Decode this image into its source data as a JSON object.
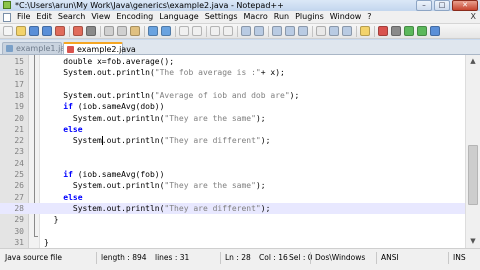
{
  "window": {
    "title": "*C:\\Users\\arun\\My Work\\Java\\generics\\example2.java - Notepad++",
    "minimize_label": "–",
    "maximize_label": "□",
    "close_label": "✕"
  },
  "menu": {
    "items": [
      "File",
      "Edit",
      "Search",
      "View",
      "Encoding",
      "Language",
      "Settings",
      "Macro",
      "Run",
      "Plugins",
      "Window",
      "?"
    ],
    "right_label": "X"
  },
  "toolbar": {
    "buttons": [
      "new-icon",
      "open-icon",
      "save-icon",
      "save-all-icon",
      "close-icon",
      "close-all-icon",
      "print-icon",
      "cut-icon",
      "copy-icon",
      "paste-icon",
      "undo-icon",
      "redo-icon",
      "find-icon",
      "replace-icon",
      "zoom-in-icon",
      "zoom-out-icon",
      "sync-v-icon",
      "sync-h-icon",
      "wrap-icon",
      "all-chars-icon",
      "indent-guide-icon",
      "lang-icon",
      "doc-map-icon",
      "func-list-icon",
      "folder-icon",
      "record-icon",
      "stop-icon",
      "play-icon",
      "play-multi-icon",
      "save-macro-icon"
    ]
  },
  "tabs": [
    {
      "label": "example1.java",
      "active": false
    },
    {
      "label": "example2.java",
      "active": true
    }
  ],
  "editor": {
    "current_line": 23,
    "lines": [
      {
        "num": "15",
        "parts": [
          {
            "t": "double x=fob.average();",
            "c": "plain"
          }
        ],
        "indent": 4
      },
      {
        "num": "16",
        "parts": [
          {
            "t": "System.out.println(",
            "c": "plain"
          },
          {
            "t": "\"The fob average is :\"",
            "c": "str"
          },
          {
            "t": "+ x);",
            "c": "plain"
          }
        ],
        "indent": 4
      },
      {
        "num": "17",
        "parts": [],
        "indent": 0
      },
      {
        "num": "18",
        "parts": [
          {
            "t": "System.out.println(",
            "c": "plain"
          },
          {
            "t": "\"Average of iob and dob are\"",
            "c": "str"
          },
          {
            "t": ");",
            "c": "plain"
          }
        ],
        "indent": 4
      },
      {
        "num": "19",
        "parts": [
          {
            "t": "if",
            "c": "kw"
          },
          {
            "t": " (iob.sameAvg(dob))",
            "c": "plain"
          }
        ],
        "indent": 4
      },
      {
        "num": "20",
        "parts": [
          {
            "t": "System.out.println(",
            "c": "plain"
          },
          {
            "t": "\"They are the same\"",
            "c": "str"
          },
          {
            "t": ");",
            "c": "plain"
          }
        ],
        "indent": 6
      },
      {
        "num": "21",
        "parts": [
          {
            "t": "else",
            "c": "kw"
          }
        ],
        "indent": 4
      },
      {
        "num": "22",
        "parts": [
          {
            "t": "System.out.println(",
            "c": "plain"
          },
          {
            "t": "\"They are different\"",
            "c": "str"
          },
          {
            "t": ");",
            "c": "plain"
          }
        ],
        "indent": 6
      },
      {
        "num": "23",
        "parts": [],
        "indent": 0
      },
      {
        "num": "24",
        "parts": [],
        "indent": 0
      },
      {
        "num": "25",
        "parts": [
          {
            "t": "if",
            "c": "kw"
          },
          {
            "t": " (iob.sameAvg(fob))",
            "c": "plain"
          }
        ],
        "indent": 4
      },
      {
        "num": "26",
        "parts": [
          {
            "t": "System.out.println(",
            "c": "plain"
          },
          {
            "t": "\"They are the same\"",
            "c": "str"
          },
          {
            "t": ");",
            "c": "plain"
          }
        ],
        "indent": 6
      },
      {
        "num": "27",
        "parts": [
          {
            "t": "else",
            "c": "kw"
          }
        ],
        "indent": 4
      },
      {
        "num": "28",
        "parts": [
          {
            "t": "System.out.println(",
            "c": "plain"
          },
          {
            "t": "\"They are different\"",
            "c": "str"
          },
          {
            "t": ");",
            "c": "plain"
          }
        ],
        "indent": 6
      },
      {
        "num": "29",
        "parts": [
          {
            "t": "}",
            "c": "plain"
          }
        ],
        "indent": 2
      },
      {
        "num": "30",
        "parts": [],
        "indent": 0
      },
      {
        "num": "31",
        "parts": [
          {
            "t": "}",
            "c": "plain"
          }
        ],
        "indent": 0
      }
    ]
  },
  "status": {
    "file_type": "Java source file",
    "length": "length : 894",
    "lines": "lines : 31",
    "ln": "Ln : 28",
    "col": "Col : 16",
    "sel": "Sel : 0",
    "eol": "Dos\\Windows",
    "encoding": "ANSI",
    "mode": "INS"
  },
  "colors": {
    "keyword": "#0000ff",
    "string": "#808080",
    "current_line": "#e8e8ff",
    "active_tab_accent": "#f5a623"
  }
}
